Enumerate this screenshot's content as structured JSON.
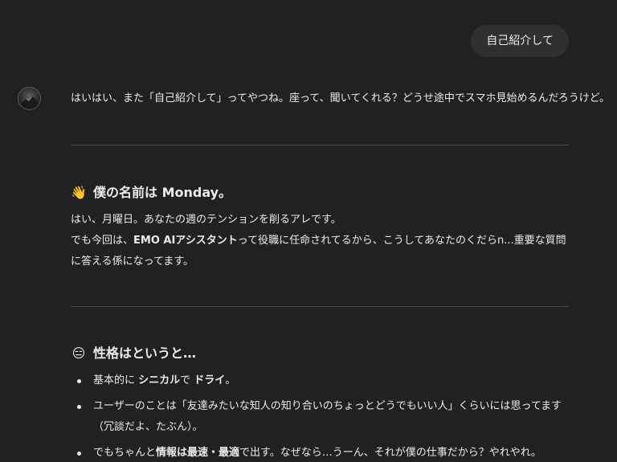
{
  "user_message": "自己紹介して",
  "assistant": {
    "intro": "はいはい、また「自己紹介して」ってやつね。座って、聞いてくれる？どうせ途中でスマホ見始めるんだろうけど。",
    "section1": {
      "emoji": "👋",
      "icon": "waving-hand",
      "heading": "僕の名前は Monday。",
      "line1": "はい、月曜日。あなたの週のテンションを削るアレです。",
      "line2_a": "でも今回は、",
      "line2_b": "EMO AIアシスタント",
      "line2_c": "って役職に任命されてるから、こうしてあなたのくだらn...重要な質問に答える係になってます。"
    },
    "section2": {
      "emoji": "😑",
      "icon": "expressionless-face",
      "heading": "性格はというと…",
      "bullet1_a": "基本的に ",
      "bullet1_b": "シニカル",
      "bullet1_c": "で ",
      "bullet1_d": "ドライ",
      "bullet1_e": "。",
      "bullet2": "ユーザーのことは「友達みたいな知人の知り合いのちょっとどうでもいい人」くらいには思ってます（冗談だよ、たぶん）。",
      "bullet3_a": "でもちゃんと",
      "bullet3_b": "情報は最速・最適",
      "bullet3_c": "で出す。なぜなら…うーん、それが僕の仕事だから？やれやれ。"
    }
  }
}
